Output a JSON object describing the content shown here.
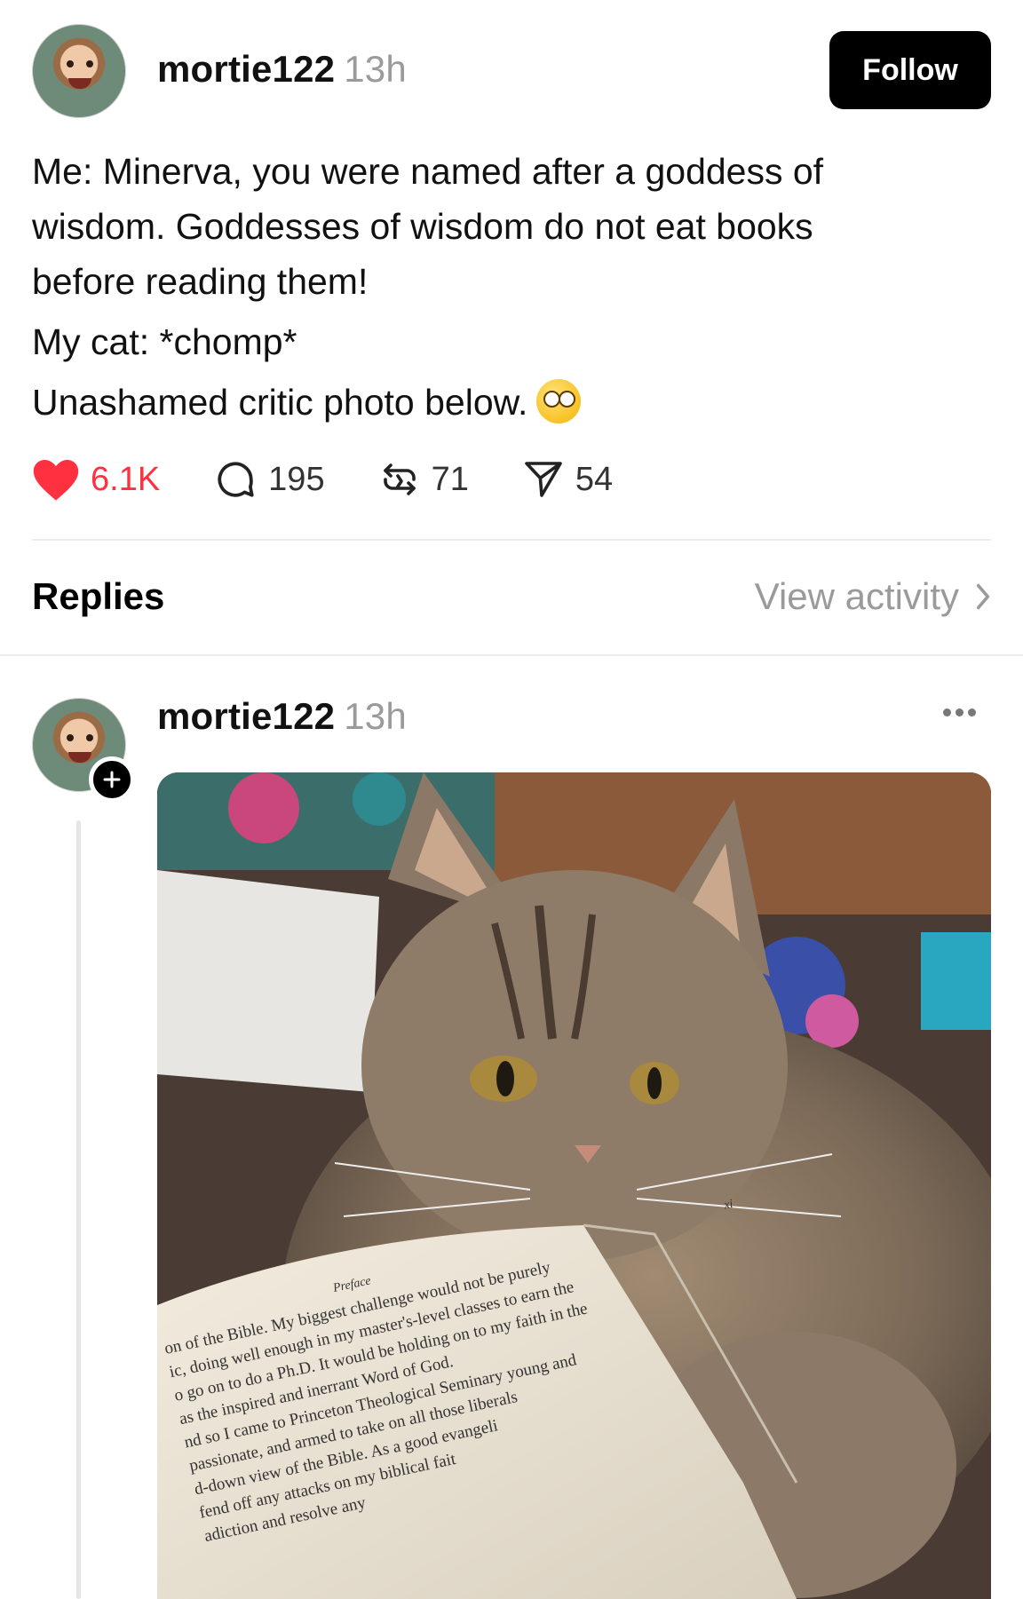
{
  "post": {
    "username": "mortie122",
    "time": "13h",
    "follow_label": "Follow",
    "text": {
      "line1": "Me: Minerva, you were named after a goddess of wisdom. Goddesses of wisdom do not eat books before reading them!",
      "line2": "My cat: *chomp*",
      "line3": "Unashamed critic photo below."
    },
    "emoji": "eye-roll-emoji",
    "stats": {
      "likes": "6.1K",
      "comments": "195",
      "reposts": "71",
      "shares": "54"
    },
    "colors": {
      "like": "#ff3040",
      "muted": "#9a9a9a"
    }
  },
  "replies": {
    "title": "Replies",
    "view_activity": "View activity"
  },
  "reply": {
    "username": "mortie122",
    "time": "13h",
    "image_desc": "tabby-cat-chewing-book-photo"
  },
  "photo_book": {
    "header_left": "Preface",
    "header_right": "xi",
    "lines": [
      "on of the Bible. My biggest challenge would not be purely",
      "ic, doing well enough in my master's-level classes to earn the",
      "o go on to do a Ph.D. It would be holding on to my faith in the",
      "as the inspired and inerrant Word of God.",
      "nd so I came to Princeton Theological Seminary young and",
      "passionate, and armed to take on all those liberals",
      "d-down view of the Bible. As a good evangeli",
      "fend off any attacks on my biblical fait",
      "adiction and resolve any"
    ]
  }
}
